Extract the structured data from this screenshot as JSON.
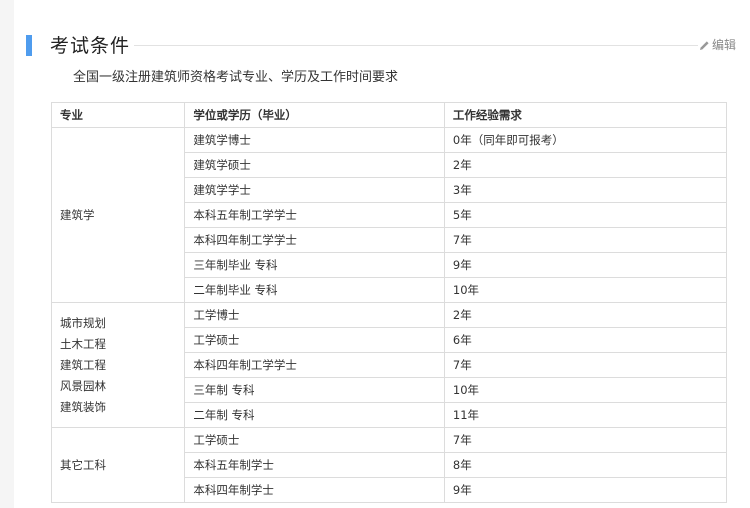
{
  "section": {
    "title": "考试条件",
    "edit_label": "编辑",
    "intro": "全国一级注册建筑师资格考试专业、学历及工作时间要求"
  },
  "table": {
    "headers": [
      "专业",
      "学位或学历（毕业）",
      "工作经验需求"
    ],
    "groups": [
      {
        "majors": [
          "建筑学"
        ],
        "rows": [
          {
            "degree": "建筑学博士",
            "experience": "0年（同年即可报考）"
          },
          {
            "degree": "建筑学硕士",
            "experience": "2年"
          },
          {
            "degree": "建筑学学士",
            "experience": "3年"
          },
          {
            "degree": "本科五年制工学学士",
            "experience": "5年"
          },
          {
            "degree": "本科四年制工学学士",
            "experience": "7年"
          },
          {
            "degree": "三年制毕业 专科",
            "experience": "9年"
          },
          {
            "degree": "二年制毕业 专科",
            "experience": "10年"
          }
        ]
      },
      {
        "majors": [
          "城市规划",
          "土木工程",
          "建筑工程",
          "风景园林",
          "建筑装饰"
        ],
        "rows": [
          {
            "degree": "工学博士",
            "experience": "2年"
          },
          {
            "degree": "工学硕士",
            "experience": "6年"
          },
          {
            "degree": "本科四年制工学学士",
            "experience": "7年"
          },
          {
            "degree": "三年制 专科",
            "experience": "10年"
          },
          {
            "degree": "二年制 专科",
            "experience": "11年"
          }
        ]
      },
      {
        "majors": [
          "其它工科"
        ],
        "rows": [
          {
            "degree": "工学硕士",
            "experience": "7年"
          },
          {
            "degree": "本科五年制学士",
            "experience": "8年"
          },
          {
            "degree": "本科四年制学士",
            "experience": "9年"
          }
        ]
      }
    ]
  }
}
